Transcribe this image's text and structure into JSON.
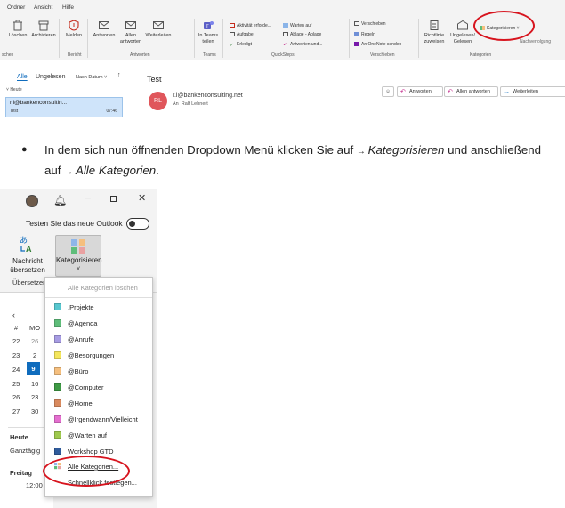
{
  "top": {
    "menu": [
      "Ordner",
      "Ansicht",
      "Hilfe"
    ],
    "ribbon": {
      "buttons": [
        "Löschen",
        "Archivieren",
        "Melden",
        "Antworten",
        "Allen antworten",
        "Weiterleiten",
        "In Teams teilen",
        "Richtlinie zuweisen",
        "Ungelesen/ Gelesen",
        "Kategorisieren",
        "Nachverfolgung"
      ],
      "quicksteps": [
        "Aktivität erforde...",
        "Aufgabe",
        "Erledigt",
        "Warten auf",
        "Ablage - Ablage",
        "Antworten und..."
      ],
      "move": [
        "Verschieben",
        "Regeln",
        "An OneNote senden"
      ],
      "groups": [
        "schen",
        "Bericht",
        "Antworten",
        "Teams",
        "QuickSteps",
        "Verschieben",
        "Kategorien"
      ]
    },
    "maillist": {
      "tabs": [
        "Alle",
        "Ungelesen"
      ],
      "sort": "Nach Datum",
      "section": "Heute",
      "item_from": "r.l@bankenconsultin...",
      "item_subject": "Test",
      "item_time": "07:46"
    },
    "reading": {
      "subject": "Test",
      "avatar": "RL",
      "from": "r.l@bankenconsulting.net",
      "to_label": "An",
      "to": "Ralf Lehnert",
      "buttons": [
        "Antworten",
        "Allen antworten",
        "Weiterleiten"
      ]
    }
  },
  "instruction": {
    "part1": "In dem sich nun öffnenden Dropdown Menü klicken Sie auf ",
    "arrow": "→ ",
    "em1": "Kategorisieren",
    "part2": " und anschließend auf ",
    "em2": "Alle Kategorien",
    "end": "."
  },
  "bottom": {
    "new_outlook": "Testen Sie das neue Outlook",
    "translate_label": "Nachricht übersetzen",
    "categorize_label": "Kategorisieren",
    "group_label": "Übersetzen",
    "clear_all": "Alle Kategorien löschen",
    "categories": [
      {
        "name": ".Projekte",
        "color": "#58c7cf"
      },
      {
        "name": "@Agenda",
        "color": "#5fbd7a"
      },
      {
        "name": "@Anrufe",
        "color": "#a79ce3"
      },
      {
        "name": "@Besorgungen",
        "color": "#f4e65c"
      },
      {
        "name": "@Büro",
        "color": "#f5bf7e"
      },
      {
        "name": "@Computer",
        "color": "#3e9a45"
      },
      {
        "name": "@Home",
        "color": "#d98a5e"
      },
      {
        "name": "@Irgendwann/Vielleicht",
        "color": "#e56fd0"
      },
      {
        "name": "@Warten auf",
        "color": "#9fc94e"
      },
      {
        "name": "Workshop GTD",
        "color": "#2f5b9b"
      }
    ],
    "all_categories": "Alle Kategorien...",
    "quick_click": "Schnellklick festlegen...",
    "calendar": {
      "weekday": "MO",
      "weeks": [
        "22",
        "23",
        "24",
        "25",
        "26",
        "27"
      ],
      "days": [
        "26",
        "2",
        "9",
        "16",
        "23",
        "30"
      ],
      "week_col": "#",
      "heute": "Heute",
      "ganztaegig": "Ganztägig",
      "freitag": "Freitag",
      "time": "12:00"
    }
  },
  "colors": {
    "accent": "#0f6cbd",
    "highlight": "#d7141e"
  }
}
